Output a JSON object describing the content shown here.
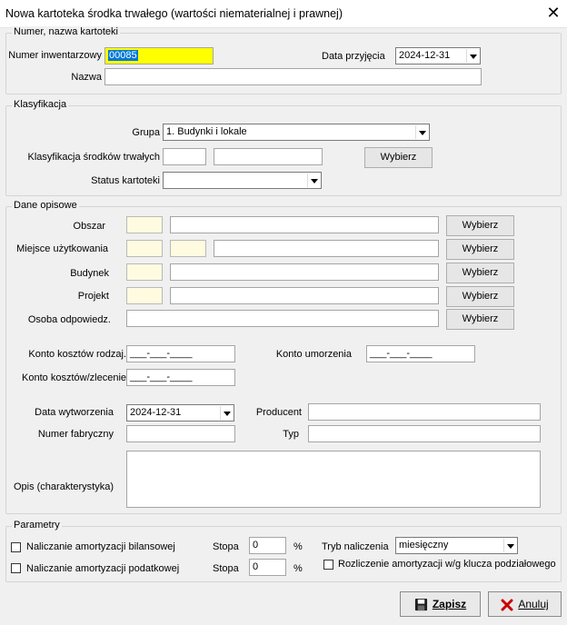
{
  "window": {
    "title": "Nowa kartoteka środka trwałego (wartości niematerialnej i prawnej)",
    "close_glyph": "✕"
  },
  "g1": {
    "legend": "Numer, nazwa kartoteki",
    "numer_label": "Numer inwentarzowy",
    "numer_value": "00085",
    "data_label": "Data przyjęcia",
    "data_value": "2024-12-31",
    "nazwa_label": "Nazwa",
    "nazwa_value": ""
  },
  "g2": {
    "legend": "Klasyfikacja",
    "grupa_label": "Grupa",
    "grupa_value": "1. Budynki i lokale",
    "klas_label": "Klasyfikacja środków trwałych",
    "klas_code": "",
    "klas_name": "",
    "wybierz": "Wybierz",
    "status_label": "Status kartoteki",
    "status_value": ""
  },
  "g3": {
    "legend": "Dane opisowe",
    "wybierz": "Wybierz",
    "obszar": "Obszar",
    "miejsce": "Miejsce użytkowania",
    "budynek": "Budynek",
    "projekt": "Projekt",
    "osoba": "Osoba odpowiedz.",
    "konto_rodzaj": "Konto kosztów rodzaj.",
    "konto_rodzaj_value": "___-___-____",
    "konto_umorz": "Konto umorzenia",
    "konto_umorz_value": "___-___-____",
    "konto_zlec": "Konto kosztów/zlecenie",
    "konto_zlec_value": "___-___-____",
    "data_wytw": "Data wytworzenia",
    "data_wytw_value": "2024-12-31",
    "producent": "Producent",
    "nr_fabr": "Numer fabryczny",
    "typ": "Typ",
    "opis": "Opis (charakterystyka)"
  },
  "g4": {
    "legend": "Parametry",
    "bilans": "Naliczanie amortyzacji bilansowej",
    "podatk": "Naliczanie amortyzacji podatkowej",
    "stopa": "Stopa",
    "stopa1": "0",
    "stopa2": "0",
    "pct": "%",
    "tryb": "Tryb naliczenia",
    "tryb_value": "miesięczny",
    "rozlicz": "Rozliczenie amortyzacji w/g klucza podziałowego"
  },
  "buttons": {
    "zapisz": "Zapisz",
    "anuluj": "Anuluj"
  },
  "colors": {
    "highlight": "#ffff00",
    "selection": "#0078d7",
    "cancel_x": "#cc0000"
  }
}
